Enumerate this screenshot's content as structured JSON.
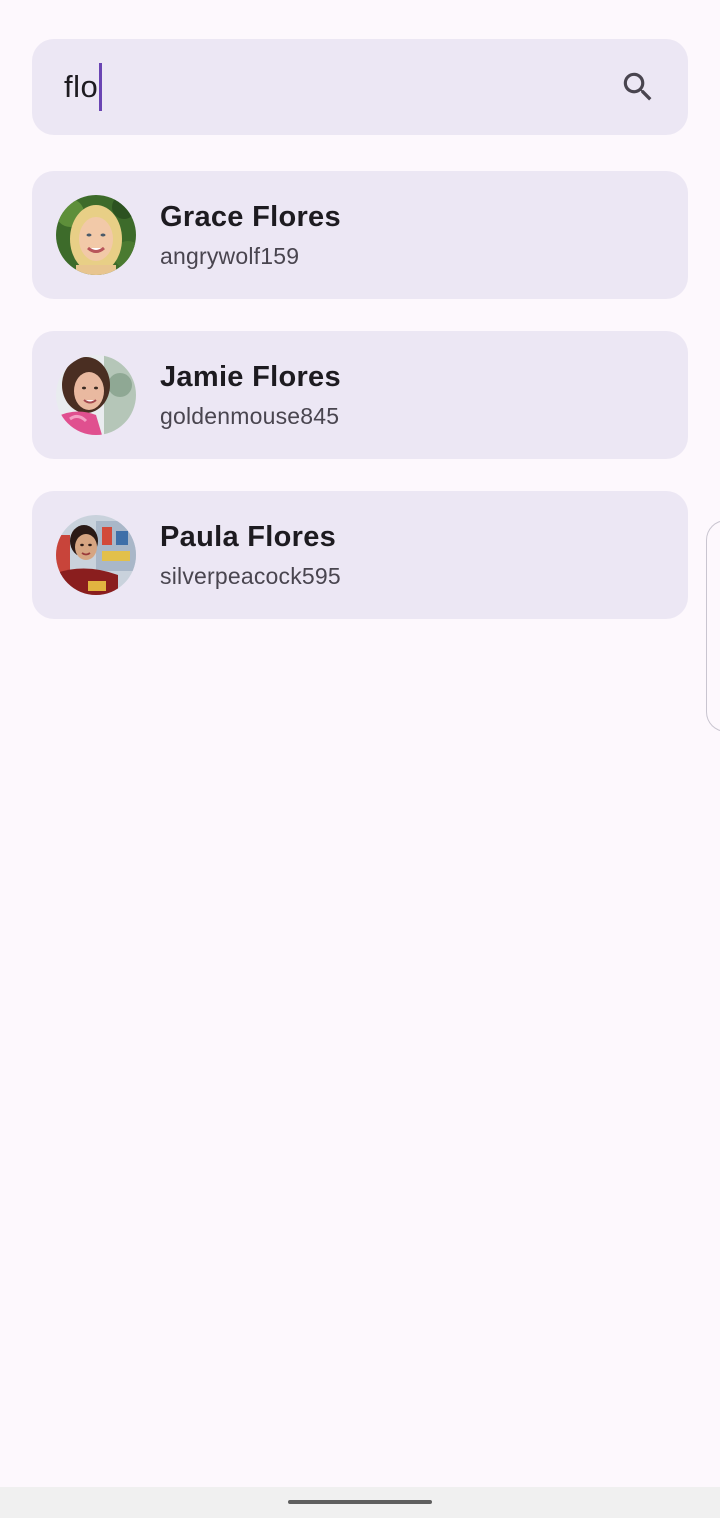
{
  "search": {
    "value": "flo",
    "icon": "search-icon"
  },
  "results": [
    {
      "name": "Grace Flores",
      "username": "angrywolf159"
    },
    {
      "name": "Jamie Flores",
      "username": "goldenmouse845"
    },
    {
      "name": "Paula Flores",
      "username": "silverpeacock595"
    }
  ],
  "colors": {
    "background": "#fdf8fd",
    "card": "#ece7f4",
    "caret": "#6a45b3",
    "text_primary": "#1d1b20",
    "text_secondary": "#49454f"
  }
}
